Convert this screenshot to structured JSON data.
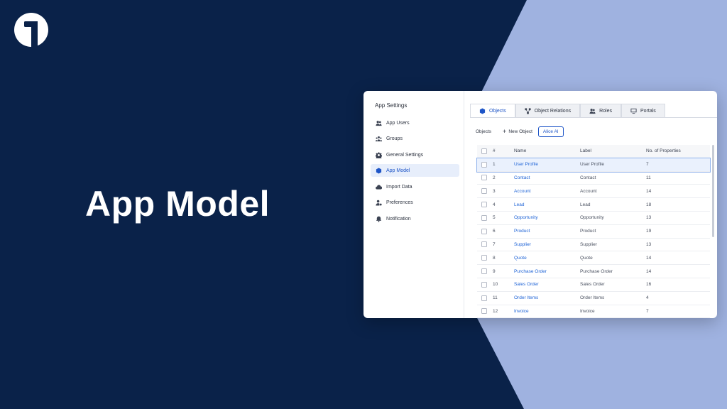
{
  "hero_title": "App Model",
  "sidebar": {
    "title": "App Settings",
    "items": [
      {
        "label": "App Users",
        "icon": "users-icon"
      },
      {
        "label": "Groups",
        "icon": "groups-icon"
      },
      {
        "label": "General Settings",
        "icon": "gear-icon"
      },
      {
        "label": "App Model",
        "icon": "cube-icon",
        "active": true
      },
      {
        "label": "Import Data",
        "icon": "cloud-upload-icon"
      },
      {
        "label": "Preferences",
        "icon": "person-settings-icon"
      },
      {
        "label": "Notification",
        "icon": "bell-icon"
      }
    ]
  },
  "tabs": [
    {
      "label": "Objects",
      "icon": "cube-icon",
      "active": true
    },
    {
      "label": "Object Relations",
      "icon": "relations-icon"
    },
    {
      "label": "Roles",
      "icon": "roles-icon"
    },
    {
      "label": "Portals",
      "icon": "monitor-icon"
    }
  ],
  "toolbar": {
    "label": "Objects",
    "new_label": "New Object",
    "ai_label": "Alice AI"
  },
  "table": {
    "headers": {
      "num": "#",
      "name": "Name",
      "label": "Label",
      "props": "No. of Properties"
    },
    "rows": [
      {
        "num": "1",
        "name": "User Profile",
        "label": "User Profile",
        "props": "7"
      },
      {
        "num": "2",
        "name": "Contact",
        "label": "Contact",
        "props": "11"
      },
      {
        "num": "3",
        "name": "Account",
        "label": "Account",
        "props": "14"
      },
      {
        "num": "4",
        "name": "Lead",
        "label": "Lead",
        "props": "18"
      },
      {
        "num": "5",
        "name": "Opportunity",
        "label": "Opportunity",
        "props": "13"
      },
      {
        "num": "6",
        "name": "Product",
        "label": "Product",
        "props": "19"
      },
      {
        "num": "7",
        "name": "Supplier",
        "label": "Supplier",
        "props": "13"
      },
      {
        "num": "8",
        "name": "Quote",
        "label": "Quote",
        "props": "14"
      },
      {
        "num": "9",
        "name": "Purchase Order",
        "label": "Purchase Order",
        "props": "14"
      },
      {
        "num": "10",
        "name": "Sales Order",
        "label": "Sales Order",
        "props": "16"
      },
      {
        "num": "11",
        "name": "Order Items",
        "label": "Order Items",
        "props": "4"
      },
      {
        "num": "12",
        "name": "Invoice",
        "label": "Invoice",
        "props": "7"
      }
    ]
  },
  "colors": {
    "accent": "#1e55c7",
    "navy": "#0a2249",
    "periwinkle": "#9fb2e0"
  }
}
